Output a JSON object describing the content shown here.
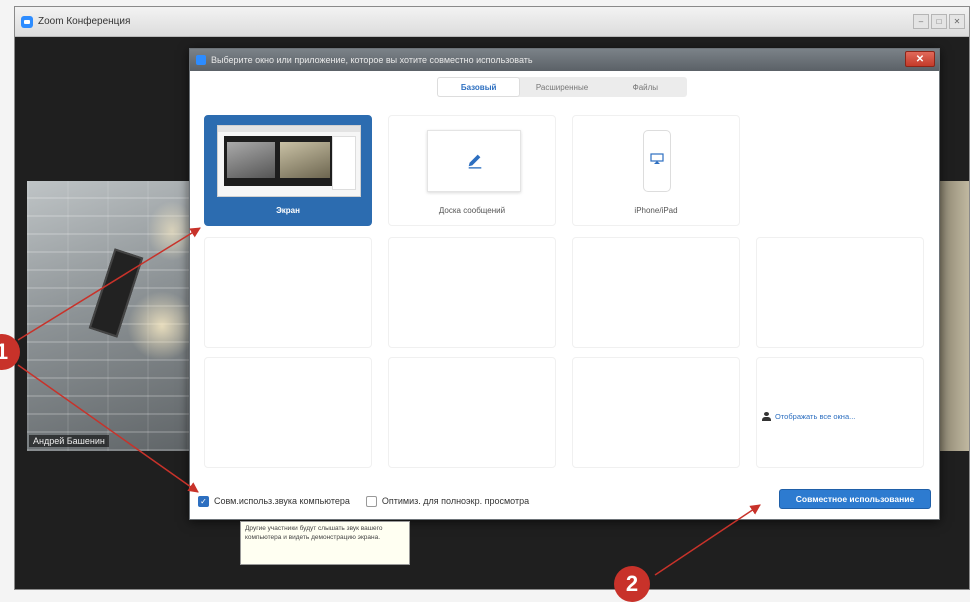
{
  "zoom_window": {
    "title": "Zoom Конференция",
    "participant_name": "Андрей Башенин"
  },
  "dialog": {
    "title": "Выберите окно или приложение, которое вы хотите совместно использовать",
    "close_label": "✕",
    "tabs": [
      {
        "label": "Базовый",
        "active": true
      },
      {
        "label": "Расширенные",
        "active": false
      },
      {
        "label": "Файлы",
        "active": false
      }
    ],
    "tiles": [
      {
        "label": "Экран",
        "icon": "screen-thumbnail",
        "selected": true
      },
      {
        "label": "Доска сообщений",
        "icon": "pencil-icon",
        "selected": false
      },
      {
        "label": "iPhone/iPad",
        "icon": "airplay-icon",
        "selected": false
      }
    ],
    "show_all_label": "Отображать все окна...",
    "checkbox_sound": {
      "label": "Совм.использ.звука компьютера",
      "checked": true
    },
    "checkbox_optimize": {
      "label": "Оптимиз. для полноэкр. просмотра",
      "checked": false
    },
    "share_button": "Совместное использование",
    "tooltip": "Другие участники будут слышать звук вашего компьютера и видеть демонстрацию экрана."
  },
  "annotations": {
    "badge_1": "1",
    "badge_2": "2",
    "accent_color": "#c8322a"
  }
}
